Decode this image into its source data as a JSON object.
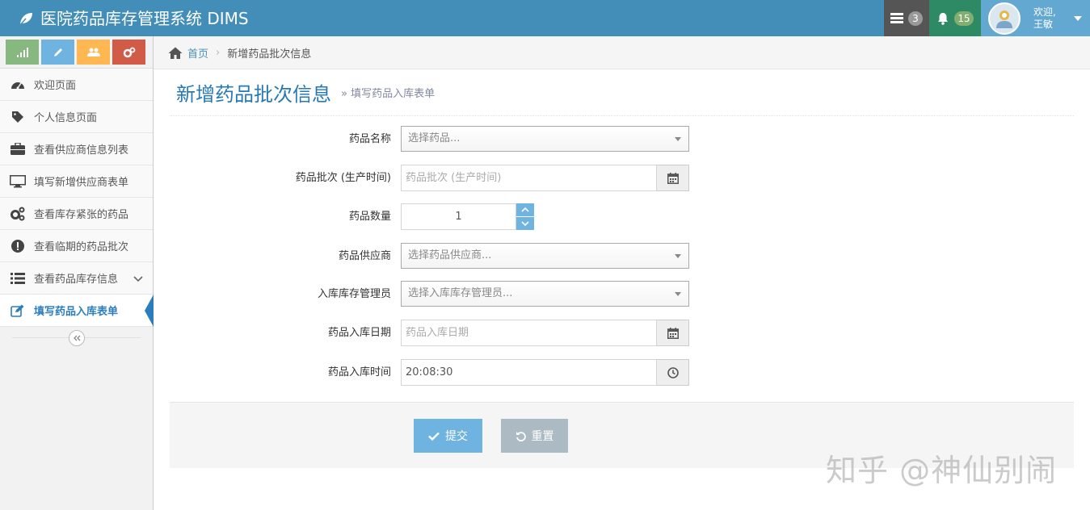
{
  "app": {
    "title": "医院药品库存管理系统 DIMS"
  },
  "navbar": {
    "tasks_count": "3",
    "notifications_count": "15",
    "user_greeting": "欢迎,",
    "user_name": "王敏"
  },
  "sidebar": {
    "items": [
      {
        "label": "欢迎页面",
        "icon": "dashboard-icon"
      },
      {
        "label": "个人信息页面",
        "icon": "tag-icon"
      },
      {
        "label": "查看供应商信息列表",
        "icon": "briefcase-icon"
      },
      {
        "label": "填写新增供应商表单",
        "icon": "desktop-icon"
      },
      {
        "label": "查看库存紧张的药品",
        "icon": "cogs-icon"
      },
      {
        "label": "查看临期的药品批次",
        "icon": "exclamation-icon"
      },
      {
        "label": "查看药品库存信息",
        "icon": "list-icon"
      },
      {
        "label": "填写药品入库表单",
        "icon": "edit-icon"
      }
    ]
  },
  "breadcrumb": {
    "home": "首页",
    "current": "新增药品批次信息"
  },
  "page": {
    "title": "新增药品批次信息",
    "subtitle": "填写药品入库表单"
  },
  "form": {
    "drug_name": {
      "label": "药品名称",
      "placeholder": "选择药品..."
    },
    "batch": {
      "label": "药品批次 (生产时间)",
      "placeholder": "药品批次 (生产时间)"
    },
    "quantity": {
      "label": "药品数量",
      "value": "1"
    },
    "supplier": {
      "label": "药品供应商",
      "placeholder": "选择药品供应商..."
    },
    "manager": {
      "label": "入库库存管理员",
      "placeholder": "选择入库库存管理员..."
    },
    "in_date": {
      "label": "药品入库日期",
      "placeholder": "药品入库日期"
    },
    "in_time": {
      "label": "药品入库时间",
      "value": "20:08:30"
    }
  },
  "actions": {
    "submit": "提交",
    "reset": "重置"
  },
  "watermark": "知乎 @神仙别闹",
  "colors": {
    "navbar": "#438eb9",
    "accent": "#2b7dbc",
    "submit": "#6fb3e0",
    "reset": "#abbac3"
  }
}
